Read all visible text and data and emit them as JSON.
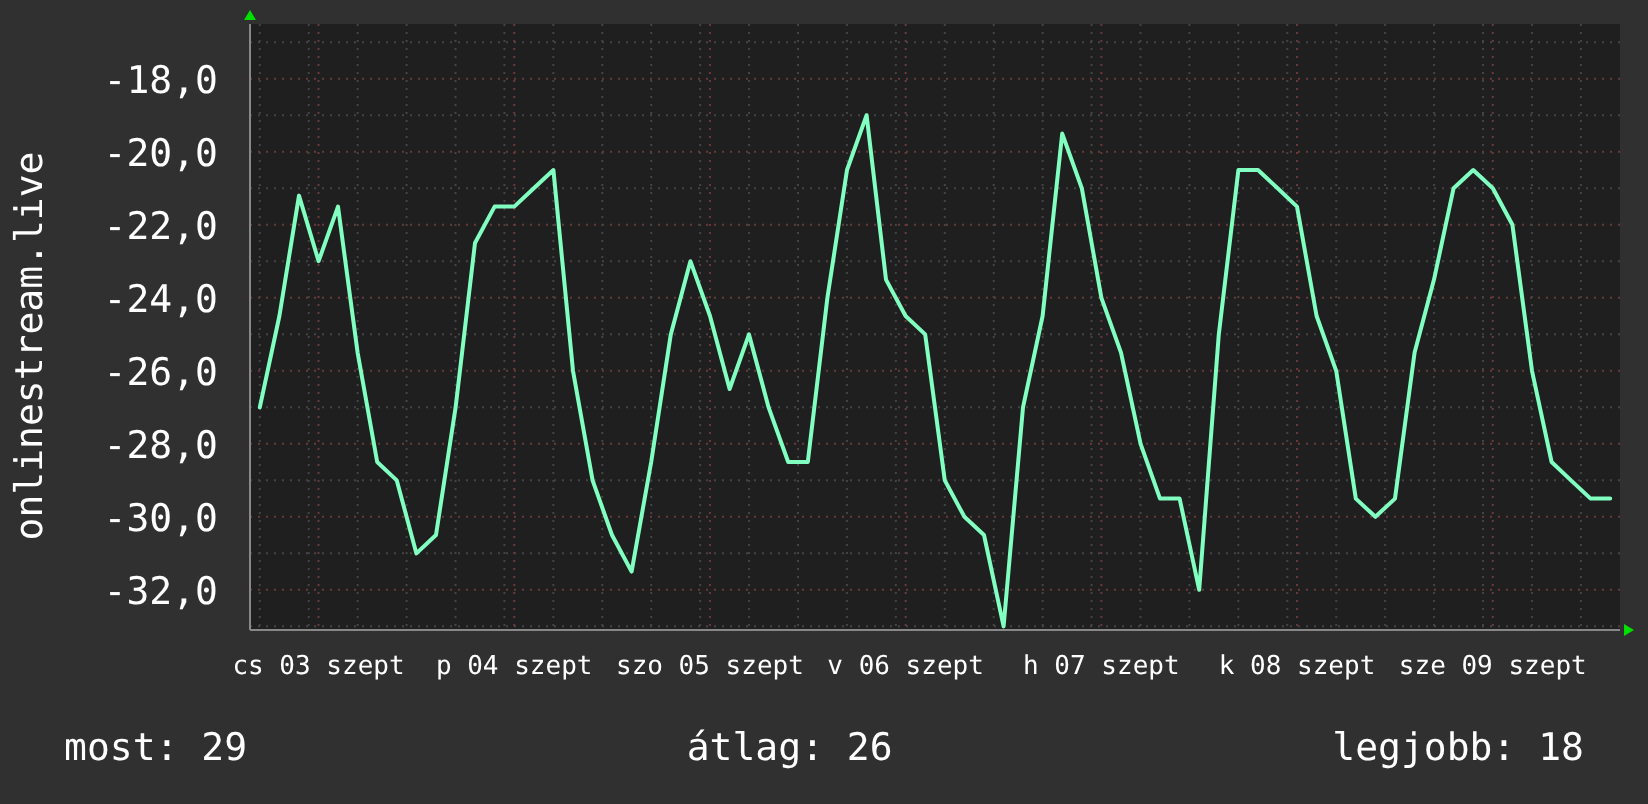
{
  "chart": {
    "chart_data": {
      "type": "line",
      "ylabel": "onlinestream.live",
      "categories": [
        null,
        null,
        null,
        "cs 03 szept",
        null,
        null,
        null,
        null,
        null,
        null,
        null,
        null,
        null,
        "p 04 szept",
        null,
        null,
        null,
        null,
        null,
        null,
        null,
        null,
        null,
        "szo 05 szept",
        null,
        null,
        null,
        null,
        null,
        null,
        null,
        null,
        null,
        "v 06 szept",
        null,
        null,
        null,
        null,
        null,
        null,
        null,
        null,
        null,
        "h 07 szept",
        null,
        null,
        null,
        null,
        null,
        null,
        null,
        null,
        null,
        "k 08 szept",
        null,
        null,
        null,
        null,
        null,
        null,
        null,
        null,
        null,
        "sze 09 szept",
        null,
        null,
        null,
        null,
        null,
        null
      ],
      "series": [
        {
          "color": "#80ffc0",
          "values": [
            -27,
            -24.5,
            -21.2,
            -23,
            -21.5,
            -25.5,
            -28.5,
            -29,
            -31,
            -30.5,
            -27,
            -22.5,
            -21.5,
            -21.5,
            -21,
            -20.5,
            -26,
            -29,
            -30.5,
            -31.5,
            -28.5,
            -25,
            -23,
            -24.5,
            -26.5,
            -25,
            -27,
            -28.5,
            -28.5,
            -24,
            -20.5,
            -19,
            -23.5,
            -24.5,
            -25,
            -29,
            -30,
            -30.5,
            -33,
            -27,
            -24.5,
            -19.5,
            -21,
            -24,
            -25.5,
            -28,
            -29.5,
            -29.5,
            -32,
            -25,
            -20.5,
            -20.5,
            -21,
            -21.5,
            -24.5,
            -26,
            -29.5,
            -30,
            -29.5,
            -25.5,
            -23.5,
            -21,
            -20.5,
            -21,
            -22,
            -26,
            -28.5,
            -29,
            -29.5,
            -29.5
          ]
        }
      ],
      "grid": true,
      "ylim": [
        -33.1,
        -16.5
      ],
      "yticks": [
        {
          "value": -18,
          "label": "-18,0"
        },
        {
          "value": -20,
          "label": "-20,0"
        },
        {
          "value": -22,
          "label": "-22,0"
        },
        {
          "value": -24,
          "label": "-24,0"
        },
        {
          "value": -26,
          "label": "-26,0"
        },
        {
          "value": -28,
          "label": "-28,0"
        },
        {
          "value": -30,
          "label": "-30,0"
        },
        {
          "value": -32,
          "label": "-32,0"
        }
      ]
    }
  },
  "stats": [
    {
      "label": "most: 29"
    },
    {
      "label": "átlag: 26"
    },
    {
      "label": "legjobb: 18"
    }
  ]
}
